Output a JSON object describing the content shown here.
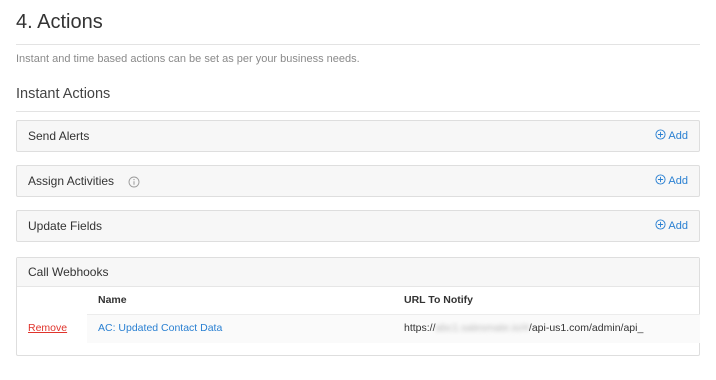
{
  "section": {
    "title": "4. Actions",
    "description": "Instant and time based actions can be set as per your business needs."
  },
  "instant": {
    "title": "Instant Actions",
    "panels": [
      {
        "label": "Send Alerts",
        "add": "Add",
        "info": false
      },
      {
        "label": "Assign Activities",
        "add": "Add",
        "info": true
      },
      {
        "label": "Update Fields",
        "add": "Add",
        "info": false
      }
    ]
  },
  "webhooks": {
    "label": "Call Webhooks",
    "columns": {
      "name": "Name",
      "url": "URL To Notify"
    },
    "rows": [
      {
        "remove": "Remove",
        "name": "AC: Updated Contact Data",
        "url_prefix": "https://",
        "url_hidden": "abc1.salesmate.io/#",
        "url_suffix": "/api-us1.com/admin/api_"
      }
    ]
  },
  "colors": {
    "link": "#2a80d2",
    "remove": "#e0342c",
    "panel_bg": "#f7f7f7",
    "border": "#dedede"
  },
  "icons": {
    "add": "plus-circle-icon",
    "info": "info-circle-icon"
  }
}
